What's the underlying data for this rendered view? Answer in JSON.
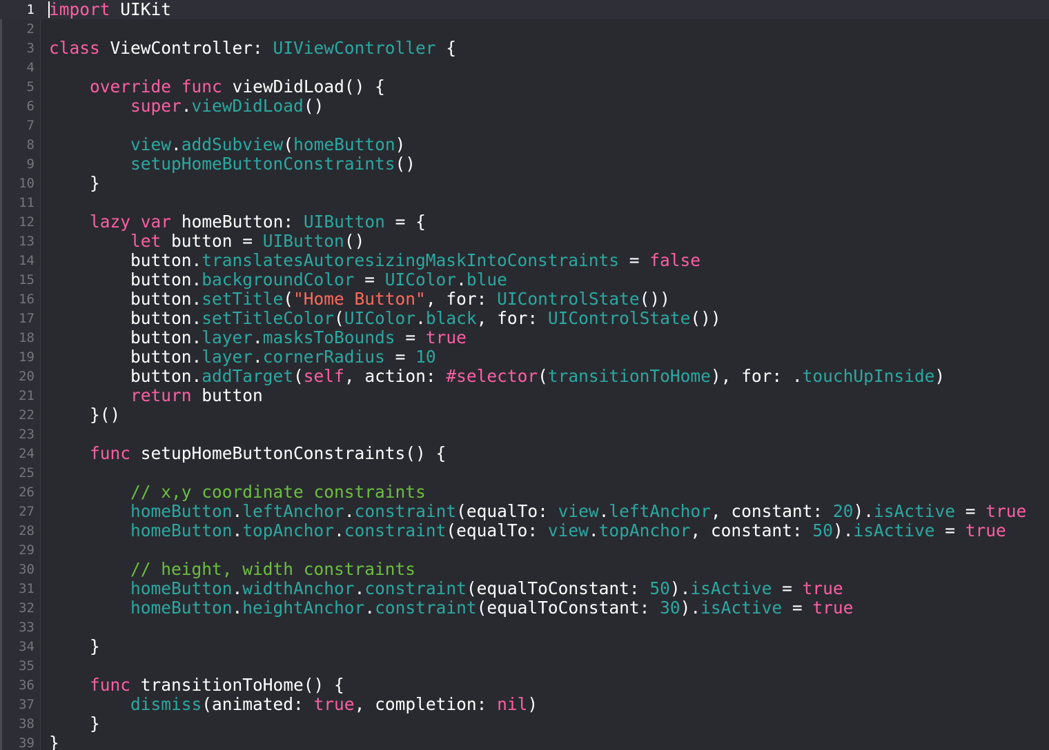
{
  "editor": {
    "language": "Swift",
    "theme_colors": {
      "background": "#292a30",
      "keyword": "#fc5fa3",
      "type": "#2ba8a0",
      "string": "#fc6a5d",
      "comment": "#6bbf3f",
      "plain": "#ffffff",
      "line_number": "#75767c"
    },
    "line_numbers": [
      "1",
      "2",
      "3",
      "4",
      "5",
      "6",
      "7",
      "8",
      "9",
      "10",
      "11",
      "12",
      "13",
      "14",
      "15",
      "16",
      "17",
      "18",
      "19",
      "20",
      "21",
      "22",
      "23",
      "24",
      "25",
      "26",
      "27",
      "28",
      "29",
      "30",
      "31",
      "32",
      "33",
      "34",
      "35",
      "36",
      "37",
      "38",
      "39"
    ],
    "current_line": 1,
    "lines": [
      [
        [
          "kw",
          "import"
        ],
        [
          "pl",
          " UIKit"
        ]
      ],
      [],
      [
        [
          "kw",
          "class"
        ],
        [
          "pl",
          " ViewController: "
        ],
        [
          "ty2",
          "UIViewController"
        ],
        [
          "pl",
          " {"
        ]
      ],
      [],
      [
        [
          "pl",
          "    "
        ],
        [
          "kw",
          "override"
        ],
        [
          "pl",
          " "
        ],
        [
          "kw",
          "func"
        ],
        [
          "pl",
          " viewDidLoad() {"
        ]
      ],
      [
        [
          "pl",
          "        "
        ],
        [
          "kw",
          "super"
        ],
        [
          "pl",
          "."
        ],
        [
          "ty2",
          "viewDidLoad"
        ],
        [
          "pl",
          "()"
        ]
      ],
      [],
      [
        [
          "pl",
          "        "
        ],
        [
          "ty2",
          "view"
        ],
        [
          "pl",
          "."
        ],
        [
          "ty2",
          "addSubview"
        ],
        [
          "pl",
          "("
        ],
        [
          "ty2",
          "homeButton"
        ],
        [
          "pl",
          ")"
        ]
      ],
      [
        [
          "pl",
          "        "
        ],
        [
          "ty2",
          "setupHomeButtonConstraints"
        ],
        [
          "pl",
          "()"
        ]
      ],
      [
        [
          "pl",
          "    }"
        ]
      ],
      [],
      [
        [
          "pl",
          "    "
        ],
        [
          "kw",
          "lazy"
        ],
        [
          "pl",
          " "
        ],
        [
          "kw",
          "var"
        ],
        [
          "pl",
          " homeButton: "
        ],
        [
          "ty2",
          "UIButton"
        ],
        [
          "pl",
          " = {"
        ]
      ],
      [
        [
          "pl",
          "        "
        ],
        [
          "kw",
          "let"
        ],
        [
          "pl",
          " button = "
        ],
        [
          "ty2",
          "UIButton"
        ],
        [
          "pl",
          "()"
        ]
      ],
      [
        [
          "pl",
          "        button."
        ],
        [
          "ty2",
          "translatesAutoresizingMaskIntoConstraints"
        ],
        [
          "pl",
          " = "
        ],
        [
          "kw",
          "false"
        ]
      ],
      [
        [
          "pl",
          "        button."
        ],
        [
          "ty2",
          "backgroundColor"
        ],
        [
          "pl",
          " = "
        ],
        [
          "ty2",
          "UIColor"
        ],
        [
          "pl",
          "."
        ],
        [
          "ty2",
          "blue"
        ]
      ],
      [
        [
          "pl",
          "        button."
        ],
        [
          "ty2",
          "setTitle"
        ],
        [
          "pl",
          "("
        ],
        [
          "st",
          "\"Home Button\""
        ],
        [
          "pl",
          ", for: "
        ],
        [
          "ty2",
          "UIControlState"
        ],
        [
          "pl",
          "())"
        ]
      ],
      [
        [
          "pl",
          "        button."
        ],
        [
          "ty2",
          "setTitleColor"
        ],
        [
          "pl",
          "("
        ],
        [
          "ty2",
          "UIColor"
        ],
        [
          "pl",
          "."
        ],
        [
          "ty2",
          "black"
        ],
        [
          "pl",
          ", for: "
        ],
        [
          "ty2",
          "UIControlState"
        ],
        [
          "pl",
          "())"
        ]
      ],
      [
        [
          "pl",
          "        button."
        ],
        [
          "ty2",
          "layer"
        ],
        [
          "pl",
          "."
        ],
        [
          "ty2",
          "masksToBounds"
        ],
        [
          "pl",
          " = "
        ],
        [
          "kw",
          "true"
        ]
      ],
      [
        [
          "pl",
          "        button."
        ],
        [
          "ty2",
          "layer"
        ],
        [
          "pl",
          "."
        ],
        [
          "ty2",
          "cornerRadius"
        ],
        [
          "pl",
          " = "
        ],
        [
          "ty2",
          "10"
        ]
      ],
      [
        [
          "pl",
          "        button."
        ],
        [
          "ty2",
          "addTarget"
        ],
        [
          "pl",
          "("
        ],
        [
          "kw",
          "self"
        ],
        [
          "pl",
          ", action: "
        ],
        [
          "kw",
          "#selector"
        ],
        [
          "pl",
          "("
        ],
        [
          "ty2",
          "transitionToHome"
        ],
        [
          "pl",
          "), for: ."
        ],
        [
          "ty2",
          "touchUpInside"
        ],
        [
          "pl",
          ")"
        ]
      ],
      [
        [
          "pl",
          "        "
        ],
        [
          "kw",
          "return"
        ],
        [
          "pl",
          " button"
        ]
      ],
      [
        [
          "pl",
          "    }()"
        ]
      ],
      [],
      [
        [
          "pl",
          "    "
        ],
        [
          "kw",
          "func"
        ],
        [
          "pl",
          " setupHomeButtonConstraints() {"
        ]
      ],
      [],
      [
        [
          "pl",
          "        "
        ],
        [
          "cm",
          "// x,y coordinate constraints"
        ]
      ],
      [
        [
          "pl",
          "        "
        ],
        [
          "ty2",
          "homeButton"
        ],
        [
          "pl",
          "."
        ],
        [
          "ty2",
          "leftAnchor"
        ],
        [
          "pl",
          "."
        ],
        [
          "ty2",
          "constraint"
        ],
        [
          "pl",
          "(equalTo: "
        ],
        [
          "ty2",
          "view"
        ],
        [
          "pl",
          "."
        ],
        [
          "ty2",
          "leftAnchor"
        ],
        [
          "pl",
          ", constant: "
        ],
        [
          "ty2",
          "20"
        ],
        [
          "pl",
          ")."
        ],
        [
          "ty2",
          "isActive"
        ],
        [
          "pl",
          " = "
        ],
        [
          "kw",
          "true"
        ]
      ],
      [
        [
          "pl",
          "        "
        ],
        [
          "ty2",
          "homeButton"
        ],
        [
          "pl",
          "."
        ],
        [
          "ty2",
          "topAnchor"
        ],
        [
          "pl",
          "."
        ],
        [
          "ty2",
          "constraint"
        ],
        [
          "pl",
          "(equalTo: "
        ],
        [
          "ty2",
          "view"
        ],
        [
          "pl",
          "."
        ],
        [
          "ty2",
          "topAnchor"
        ],
        [
          "pl",
          ", constant: "
        ],
        [
          "ty2",
          "50"
        ],
        [
          "pl",
          ")."
        ],
        [
          "ty2",
          "isActive"
        ],
        [
          "pl",
          " = "
        ],
        [
          "kw",
          "true"
        ]
      ],
      [],
      [
        [
          "pl",
          "        "
        ],
        [
          "cm",
          "// height, width constraints"
        ]
      ],
      [
        [
          "pl",
          "        "
        ],
        [
          "ty2",
          "homeButton"
        ],
        [
          "pl",
          "."
        ],
        [
          "ty2",
          "widthAnchor"
        ],
        [
          "pl",
          "."
        ],
        [
          "ty2",
          "constraint"
        ],
        [
          "pl",
          "(equalToConstant: "
        ],
        [
          "ty2",
          "50"
        ],
        [
          "pl",
          ")."
        ],
        [
          "ty2",
          "isActive"
        ],
        [
          "pl",
          " = "
        ],
        [
          "kw",
          "true"
        ]
      ],
      [
        [
          "pl",
          "        "
        ],
        [
          "ty2",
          "homeButton"
        ],
        [
          "pl",
          "."
        ],
        [
          "ty2",
          "heightAnchor"
        ],
        [
          "pl",
          "."
        ],
        [
          "ty2",
          "constraint"
        ],
        [
          "pl",
          "(equalToConstant: "
        ],
        [
          "ty2",
          "30"
        ],
        [
          "pl",
          ")."
        ],
        [
          "ty2",
          "isActive"
        ],
        [
          "pl",
          " = "
        ],
        [
          "kw",
          "true"
        ]
      ],
      [],
      [
        [
          "pl",
          "    }"
        ]
      ],
      [],
      [
        [
          "pl",
          "    "
        ],
        [
          "kw",
          "func"
        ],
        [
          "pl",
          " transitionToHome() {"
        ]
      ],
      [
        [
          "pl",
          "        "
        ],
        [
          "ty2",
          "dismiss"
        ],
        [
          "pl",
          "(animated: "
        ],
        [
          "kw",
          "true"
        ],
        [
          "pl",
          ", completion: "
        ],
        [
          "kw",
          "nil"
        ],
        [
          "pl",
          ")"
        ]
      ],
      [
        [
          "pl",
          "    }"
        ]
      ],
      [
        [
          "pl",
          "}"
        ]
      ]
    ]
  }
}
